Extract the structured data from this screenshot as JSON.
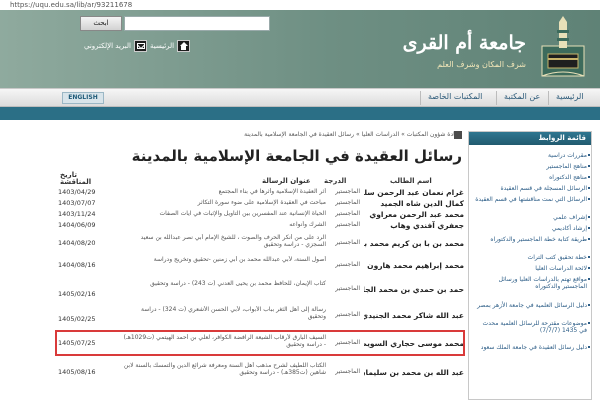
{
  "browser": {
    "url": "https://uqu.edu.sa/lib/ar/93211678"
  },
  "header": {
    "university_name": "جامعة أم القرى",
    "slogan": "شرف المكان وشرف العلم",
    "search_placeholder": "",
    "search_button": "ابحث",
    "links": [
      {
        "label": "الرئيسية",
        "icon": "home-icon"
      },
      {
        "label": "البريد الإلكتروني",
        "icon": "mail-icon"
      }
    ]
  },
  "nav": {
    "items": [
      "الرئيسية",
      "عن المكتبة",
      "المكتبات الخاصة"
    ],
    "english_button": "ENGLISH"
  },
  "breadcrumb": "عمادة شؤون المكتبات » الدراسات العليا » رسائل العقيدة في الجامعة الإسلامية بالمدينة",
  "page_title": "رسائل العقيدة في الجامعة الإسلامية بالمدينة",
  "table": {
    "headers": {
      "name": "اسم الطالب",
      "degree": "الدرجة",
      "title": "عنوان الرسالة",
      "date": "تاريخ المناقشة"
    },
    "rows": [
      {
        "name": "غرام نعمان عبد الرحمن سلهب",
        "degree": "الماجستير",
        "title": "أثر العقيدة الإسلامية وأثرها في بناء المجتمع",
        "date": "1403/04/29"
      },
      {
        "name": "كمال الدين شاه الجميد",
        "degree": "الماجستير",
        "title": "مباحث في العقيدة الإسلامية على ضوء سورة التكاثر",
        "date": "1403/07/07"
      },
      {
        "name": "محمد عبد الرحمن معراوي",
        "degree": "الماجستير",
        "title": "الحياة الإنسانية عند المفسرين بين التأويل والإثبات في آيات الصفات",
        "date": "1403/11/24"
      },
      {
        "name": "جعفري آفندي وهاب",
        "degree": "الماجستير",
        "title": "الشرك وأنواعه",
        "date": "1404/06/09"
      },
      {
        "name": "محمد بن با بن كريم محمد با عبد الله",
        "degree": "الماجستير",
        "title": "الرد على من أنكر الحرف والصوت ، للشيخ الإمام أبي نصر عبدالله بن سعيد السجزي - دراسة وتحقيق",
        "date": "1404/08/20"
      },
      {
        "name": "محمد إبراهيم محمد هارون",
        "degree": "الماجستير",
        "title": "أصول السنة، لأبي عبدالله محمد بن أبي زمنين -تحقيق وتخريج ودراسة",
        "date": "1404/08/16"
      },
      {
        "name": "حمد بن حمدي بن محمد الجابري الحربي",
        "degree": "الماجستير",
        "title": "كتاب الإيمان، للحافظ محمد بن يحيى العدني (ت 243) - دراسة وتحقيق",
        "date": "1405/02/16"
      },
      {
        "name": "عبد الله شاكر محمد الجنيدي",
        "degree": "الماجستير",
        "title": "رسالة إلى أهل الثغر بباب الأبواب، لأبي الحسن الأشعري (ت 324) - دراسة وتحقيق",
        "date": "1405/02/25"
      },
      {
        "name": "محمد موسى حجاري السويطي",
        "degree": "الماجستير",
        "title": "السيف البارق لأرقاب الشيعة الرافضة الكوافر، لعلي بن أحمد الهيتمي (ت1029هـ) - دراسة وتحقيق",
        "date": "1405/07/25"
      },
      {
        "name": "عبد الله بن محمد بن سليمان المصيري",
        "degree": "الماجستير",
        "title": "الكتاب اللطيف لشرح مذهب أهل السنة ومعرفة شرائع الدين والتمسك بالسنة لابن شاهين (ت385هـ) - دراسة وتحقيق",
        "date": "1405/08/16"
      }
    ]
  },
  "sidebar": {
    "title": "قائمة الروابط",
    "items": [
      "مقررات دراسية",
      "مناهج الماجستير",
      "مناهج الدكتوراه",
      "الرسائل المسجلة في قسم العقيدة",
      "الرسائل التي نمت مناقشتها في قسم العقيدة",
      "إشراف علمي",
      "إرشاد أكاديمي",
      "طريقة كتابة خطة الماجستير والدكتوراه",
      "خطة تحقيق كتب التراث",
      "لائحة الدراسات العليا",
      "مواقع تهتم بالدراسات العليا ورسائل الماجستير والدكتوراه",
      "دليل الرسائل العلمية في جامعة الأزهر بمصر",
      "موضوعات مقترحة للرسائل العلمية محدث في 1435 (7/7/7)",
      "دليل رسائل العقيدة في جامعة الملك سعود"
    ]
  }
}
